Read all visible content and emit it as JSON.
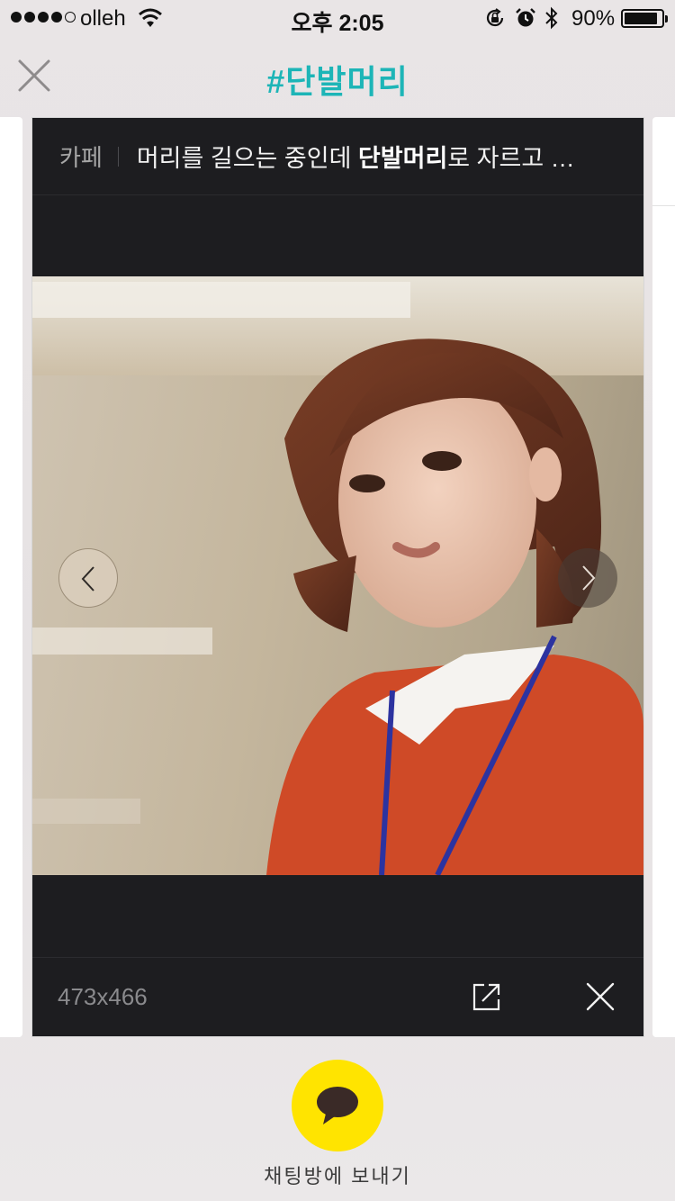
{
  "status_bar": {
    "carrier": "olleh",
    "time": "오후 2:05",
    "battery": "90%",
    "battery_level": 0.9,
    "icons": [
      "signal-dots",
      "wifi-icon",
      "rotation-lock-icon",
      "alarm-icon",
      "bluetooth-icon",
      "battery-icon"
    ]
  },
  "nav": {
    "title": "#단발머리",
    "close_icon": "close-icon"
  },
  "card": {
    "source": "카페",
    "title_pre": "머리를 길으는 중인데 ",
    "title_bold": "단발머리",
    "title_post": "로 자르고 …",
    "image_dimensions": "473x466",
    "icons": [
      "chevron-left-icon",
      "chevron-right-icon",
      "external-link-icon",
      "close-icon"
    ]
  },
  "share": {
    "icon": "chat-bubble-icon",
    "label": "채팅방에 보내기"
  },
  "colors": {
    "accent": "#1db5b7",
    "card_bg": "#1d1d20",
    "share_bg": "#ffe400"
  }
}
